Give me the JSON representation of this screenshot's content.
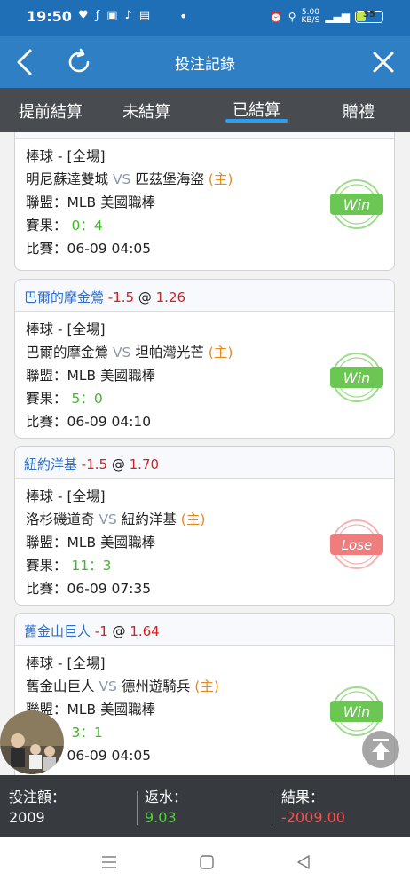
{
  "status_bar": {
    "time": "19:50",
    "net_speed": "5.00",
    "net_unit": "KB/S",
    "battery": "35"
  },
  "header": {
    "title": "投注記錄"
  },
  "tabs": [
    {
      "label": "提前結算",
      "active": false
    },
    {
      "label": "未結算",
      "active": false
    },
    {
      "label": "已結算",
      "active": true
    },
    {
      "label": "贈禮",
      "active": false
    }
  ],
  "labels": {
    "league": "聯盟：",
    "result": "賽果：",
    "match": "比賽：",
    "vs": "VS",
    "home": "(主)",
    "at": "@"
  },
  "bets": [
    {
      "pick": "",
      "handicap": "",
      "odds": "",
      "sport": "棒球 - [全場]",
      "team_a": "明尼蘇達雙城",
      "team_b": "匹茲堡海盜",
      "league": "MLB 美國職棒",
      "score": "0：4",
      "time": "06-09 04:05",
      "outcome": "Win"
    },
    {
      "pick": "巴爾的摩金鶯",
      "handicap": "-1.5",
      "odds": "1.26",
      "sport": "棒球 - [全場]",
      "team_a": "巴爾的摩金鶯",
      "team_b": "坦帕灣光芒",
      "league": "MLB 美國職棒",
      "score": "5：0",
      "time": "06-09 04:10",
      "outcome": "Win"
    },
    {
      "pick": "紐約洋基",
      "handicap": "-1.5",
      "odds": "1.70",
      "sport": "棒球 - [全場]",
      "team_a": "洛杉磯道奇",
      "team_b": "紐約洋基",
      "league": "MLB 美國職棒",
      "score": "11：3",
      "time": "06-09 07:35",
      "outcome": "Lose"
    },
    {
      "pick": "舊金山巨人",
      "handicap": "-1",
      "odds": "1.64",
      "sport": "棒球 - [全場]",
      "team_a": "舊金山巨人",
      "team_b": "德州遊騎兵",
      "league": "MLB 美國職棒",
      "score": "3：1",
      "time": "06-09 04:05",
      "outcome": "Win"
    }
  ],
  "totals": {
    "stake_label": "投注額：",
    "stake_value": "2009",
    "rebate_label": "返水：",
    "rebate_value": "9.03",
    "result_label": "結果：",
    "result_value": "-2009.00"
  },
  "colors": {
    "header_blue": "#2f7fc4",
    "tab_bar": "#484c50",
    "win_green": "#6cc653",
    "lose_red": "#f07d7d",
    "team_blue": "#2a6fd0",
    "odds_red": "#d32020",
    "home_orange": "#e8891c"
  }
}
